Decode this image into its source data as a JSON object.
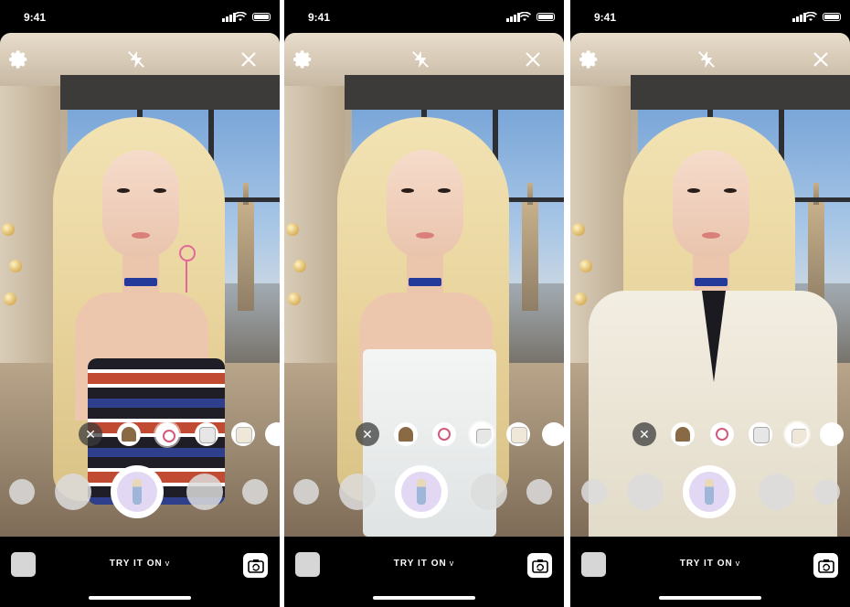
{
  "screens": [
    {
      "status": {
        "time": "9:41"
      },
      "outfit": "striped-top",
      "active_tray_item": 1,
      "footer": {
        "mode_label": "TRY IT ON",
        "mode_caret": "v"
      }
    },
    {
      "status": {
        "time": "9:41"
      },
      "outfit": "white-top",
      "active_tray_item": 3,
      "footer": {
        "mode_label": "TRY IT ON",
        "mode_caret": "v"
      }
    },
    {
      "status": {
        "time": "9:41"
      },
      "outfit": "cardigan",
      "active_tray_item": 4,
      "footer": {
        "mode_label": "TRY IT ON",
        "mode_caret": "v"
      }
    }
  ],
  "toolbar_icons": [
    "gear-icon",
    "flash-off-icon",
    "close-icon"
  ],
  "tray_icons": [
    "remove-icon",
    "hat-icon",
    "earrings-icon",
    "top-icon",
    "cardigan-icon",
    "blank-item"
  ],
  "colors": {
    "accent_avatar_bg": "#e3d8f3",
    "choker": "#233a9a"
  }
}
